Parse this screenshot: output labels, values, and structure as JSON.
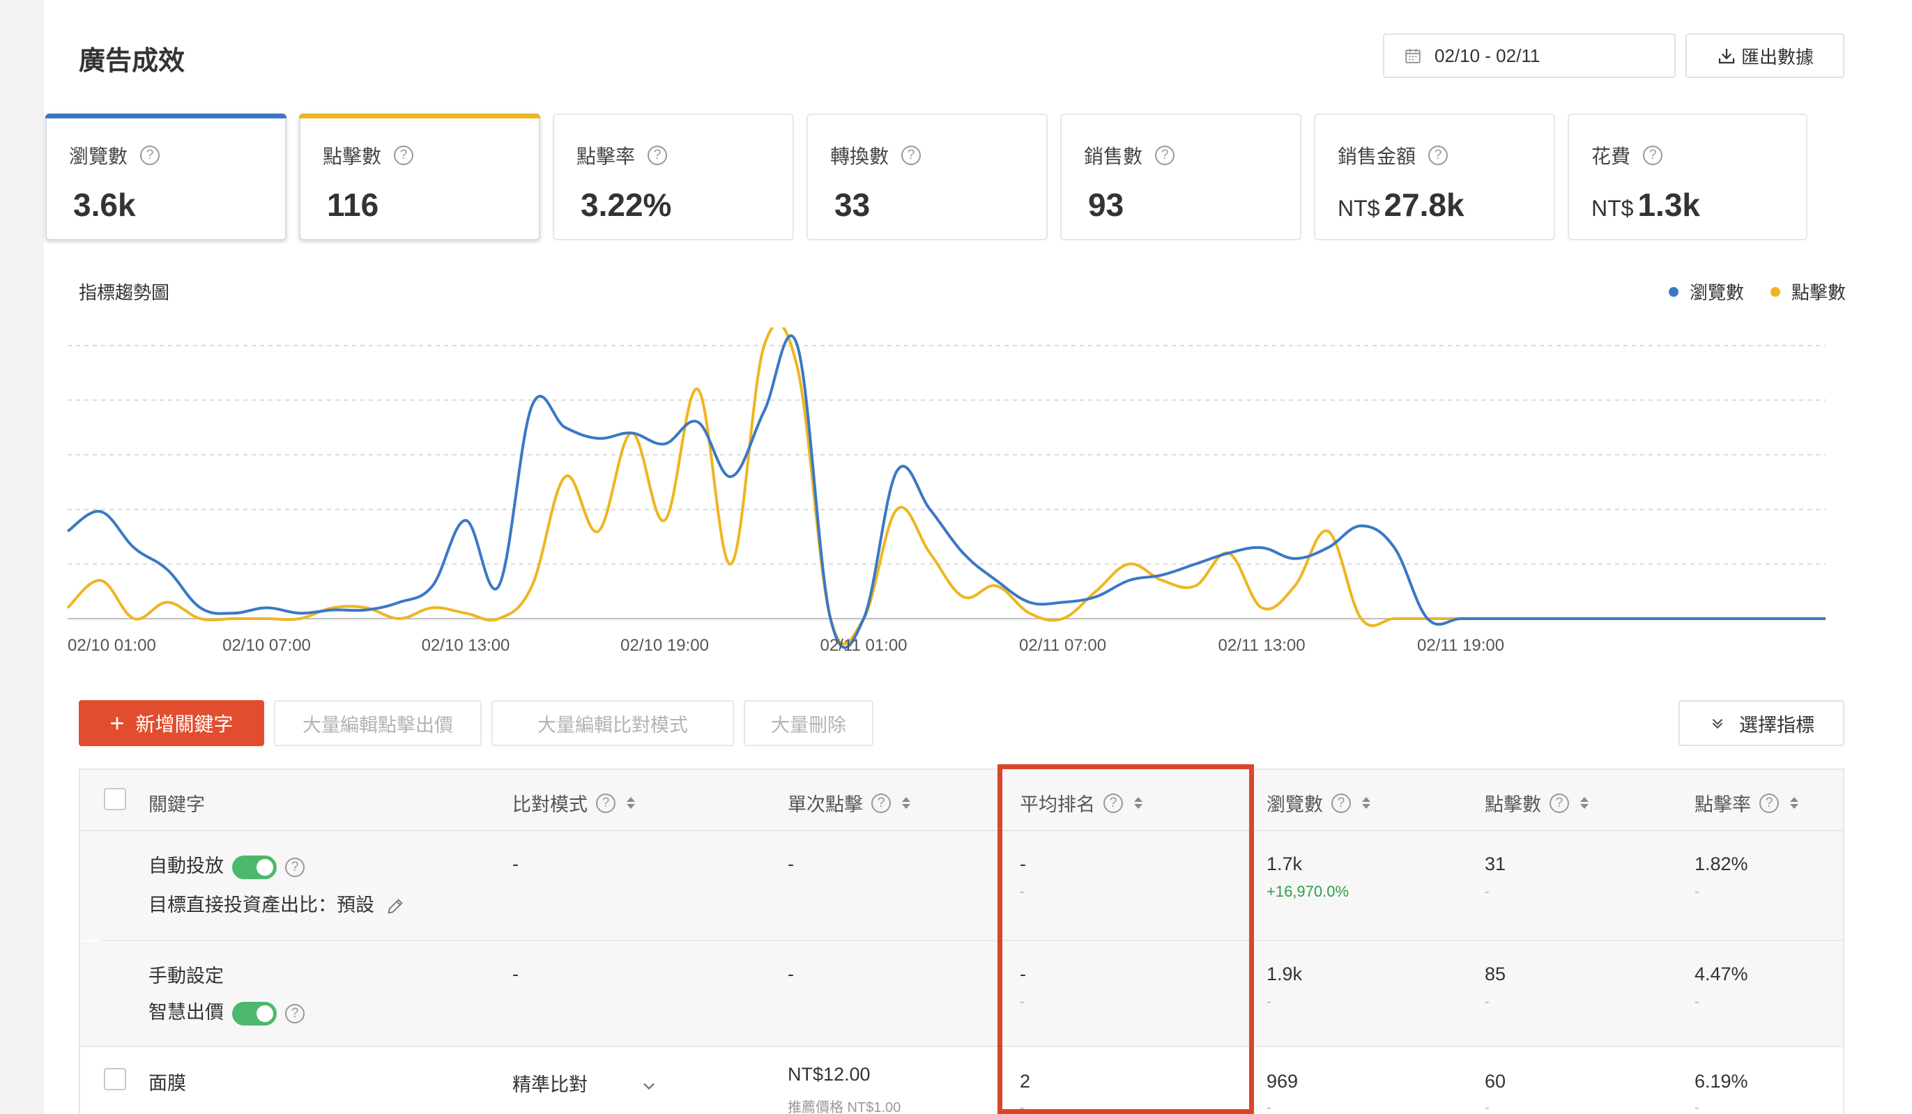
{
  "page": {
    "title": "廣告成效",
    "date_range": "02/10 - 02/11",
    "export_label": "匯出數據"
  },
  "kpis": [
    {
      "label": "瀏覽數",
      "value": "3.6k",
      "currency": "",
      "selected": true,
      "color": "#3a78c4"
    },
    {
      "label": "點擊數",
      "value": "116",
      "currency": "",
      "selected": true,
      "color": "#efb521"
    },
    {
      "label": "點擊率",
      "value": "3.22%",
      "currency": "",
      "selected": false
    },
    {
      "label": "轉換數",
      "value": "33",
      "currency": "",
      "selected": false
    },
    {
      "label": "銷售數",
      "value": "93",
      "currency": "",
      "selected": false
    },
    {
      "label": "銷售金額",
      "value": "27.8k",
      "currency": "NT$",
      "selected": false
    },
    {
      "label": "花費",
      "value": "1.3k",
      "currency": "NT$",
      "selected": false
    }
  ],
  "trend": {
    "title": "指標趨勢圖",
    "legend": [
      {
        "name": "瀏覽數",
        "color": "#3a78c4"
      },
      {
        "name": "點擊數",
        "color": "#efb521"
      }
    ]
  },
  "chart_data": {
    "type": "line",
    "x_tick_labels": [
      "02/10 01:00",
      "02/10 07:00",
      "02/10 13:00",
      "02/10 19:00",
      "02/11 01:00",
      "02/11 07:00",
      "02/11 13:00",
      "02/11 19:00"
    ],
    "x_start": "02/10 01:00",
    "x_step_hours": 1,
    "ylim": [
      0,
      250
    ],
    "grid": true,
    "series": [
      {
        "name": "瀏覽數",
        "color": "#3a78c4",
        "values": [
          80,
          98,
          65,
          45,
          10,
          5,
          10,
          5,
          8,
          8,
          15,
          30,
          90,
          30,
          195,
          175,
          165,
          170,
          160,
          180,
          130,
          190,
          250,
          0,
          0,
          135,
          100,
          60,
          35,
          15,
          15,
          20,
          35,
          40,
          50,
          60,
          65,
          55,
          65,
          85,
          65,
          0,
          0,
          0,
          0,
          0,
          0,
          0,
          0,
          0,
          0,
          0,
          0,
          0
        ]
      },
      {
        "name": "點擊數",
        "color": "#efb521",
        "values": [
          10,
          35,
          0,
          15,
          0,
          0,
          0,
          0,
          10,
          10,
          0,
          10,
          5,
          0,
          30,
          130,
          80,
          170,
          90,
          210,
          50,
          250,
          230,
          0,
          0,
          100,
          60,
          20,
          30,
          5,
          0,
          25,
          50,
          35,
          30,
          60,
          10,
          30,
          80,
          0,
          0,
          0,
          0,
          0,
          0,
          0,
          0,
          0,
          0,
          0,
          0,
          0,
          0,
          0
        ]
      }
    ]
  },
  "actions": {
    "add_keyword": "新增關鍵字",
    "bulk_edit_bid": "大量編輯點擊出價",
    "bulk_edit_match": "大量編輯比對模式",
    "bulk_delete": "大量刪除",
    "select_metrics": "選擇指標"
  },
  "table": {
    "headers": {
      "keyword": "關鍵字",
      "match_type": "比對模式",
      "cpc": "單次點擊",
      "avg_rank": "平均排名",
      "views": "瀏覽數",
      "clicks": "點擊數",
      "ctr": "點擊率"
    },
    "rows": [
      {
        "keyword": "自動投放",
        "keyword_sub": "目標直接投資產出比：預設",
        "match_type": "-",
        "cpc": "-",
        "avg_rank": "-",
        "avg_rank_sub": "-",
        "views": "1.7k",
        "views_sub": "+16,970.0%",
        "clicks": "31",
        "clicks_sub": "-",
        "ctr": "1.82%",
        "ctr_sub": "-"
      },
      {
        "keyword": "手動設定",
        "keyword_sub": "智慧出價",
        "match_type": "-",
        "cpc": "-",
        "avg_rank": "-",
        "avg_rank_sub": "-",
        "views": "1.9k",
        "views_sub": "-",
        "clicks": "85",
        "clicks_sub": "-",
        "ctr": "4.47%",
        "ctr_sub": "-"
      },
      {
        "keyword": "面膜",
        "match_type": "精準比對",
        "cpc": "NT$12.00",
        "cpc_sub": "推薦價格 NT$1.00",
        "avg_rank": "2",
        "avg_rank_sub": "-",
        "views": "969",
        "views_sub": "-",
        "clicks": "60",
        "clicks_sub": "-",
        "ctr": "6.19%",
        "ctr_sub": "-"
      }
    ]
  },
  "colors": {
    "accent": "#e24d2f",
    "highlight": "#d9472b",
    "toggle_on": "#4db86b"
  }
}
